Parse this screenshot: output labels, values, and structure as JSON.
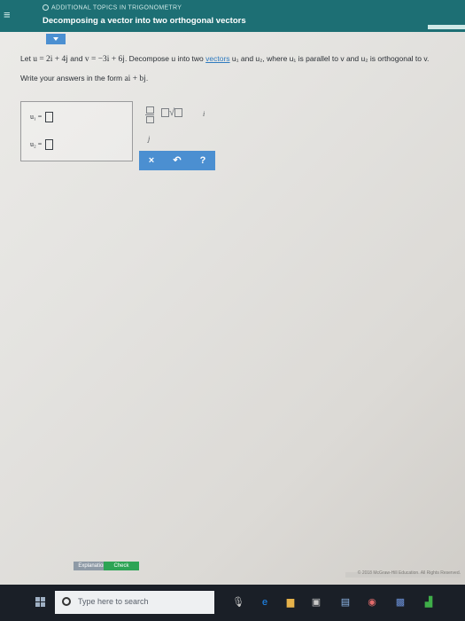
{
  "header": {
    "topic": "ADDITIONAL TOPICS IN TRIGONOMETRY",
    "title": "Decomposing a vector into two orthogonal vectors"
  },
  "problem": {
    "prefix": "Let ",
    "u_def": "u = 2i + 4j",
    "and": " and ",
    "v_def": "v = −3i + 6j",
    "mid": ". Decompose u into two ",
    "link": "vectors",
    "tail": " u₁ and u₂, where u₁ is parallel to v and u₂ is orthogonal to v.",
    "instruction_prefix": "Write your answers in the form ",
    "instruction_form": "ai + bj",
    "instruction_suffix": "."
  },
  "answers": {
    "u1_label": "u₁ =",
    "u2_label": "u₂ ="
  },
  "palette": {
    "sqrt_symbol": "√",
    "i_symbol": "i",
    "j_symbol": "j",
    "clear_label": "×",
    "undo_label": "↶",
    "help_label": "?"
  },
  "footer": {
    "explanation_label": "Explanation",
    "check_label": "Check",
    "copyright": "© 2018 McGraw-Hill Education. All Rights Reserved."
  },
  "taskbar": {
    "search_placeholder": "Type here to search"
  },
  "colors": {
    "header": "#1d6f74",
    "palette_buttons": "#4b8fd1",
    "check": "#2da455",
    "link": "#2f7bbf"
  }
}
